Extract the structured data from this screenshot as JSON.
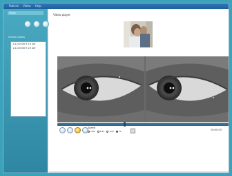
{
  "titlebar": {
    "menus": [
      "Patient",
      "Video",
      "Help"
    ]
  },
  "sidebar": {
    "title": "Video",
    "sessions_label": "Stored videos",
    "sessions": [
      "1/12/2008 9:19 AM",
      "1/12/2008 9:20 AM"
    ]
  },
  "main": {
    "title": "Video player"
  },
  "controls": {
    "speed_label": "Speed",
    "speed_options": [
      "1/8x",
      "1/4x",
      "1/2x",
      "1x"
    ],
    "selected_speed_index": 3,
    "time": "00:00:03"
  },
  "colors": {
    "background": "#3aa2bb",
    "sidebar": "#2e86a3",
    "seekbar": "#2a5f84",
    "active_button": "#e5a21c"
  }
}
